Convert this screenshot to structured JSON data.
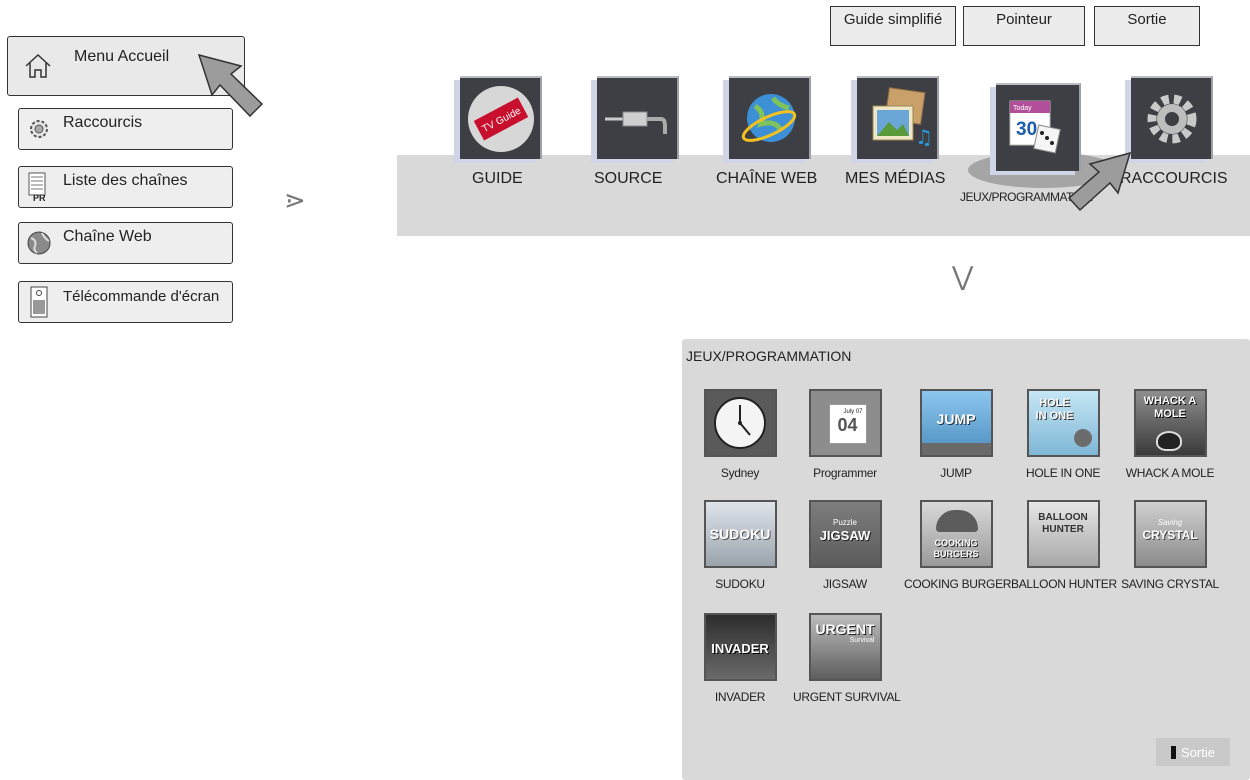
{
  "left_menu": {
    "home": "Menu Accueil",
    "items": [
      "Raccourcis",
      "Liste des chaînes",
      "Chaîne Web",
      "Télécommande d'écran"
    ],
    "channel_list_badge": "PR"
  },
  "arrows": {
    "right": "⋗",
    "down": "⋁"
  },
  "top_buttons": {
    "simple_guide": "Guide simplifié",
    "pointer": "Pointeur",
    "exit": "Sortie"
  },
  "home_bar": {
    "items": [
      "GUIDE",
      "SOURCE",
      "CHAÎNE WEB",
      "MES MÉDIAS",
      "JEUX/PROGRAMMATION",
      "RACCOURCIS"
    ],
    "selected": "JEUX/PROGRAMMATION",
    "guide_tile_text": "TV Guide",
    "calendar_tile_text": {
      "top": "Today",
      "number": "30"
    }
  },
  "games_panel": {
    "title": "JEUX/PROGRAMMATION",
    "items": [
      {
        "label": "Sydney",
        "thumb": "Sydney"
      },
      {
        "label": "Programmer",
        "thumb": "04",
        "thumb_top": "July 07"
      },
      {
        "label": "JUMP",
        "thumb": "JUMP"
      },
      {
        "label": "HOLE IN ONE",
        "thumb": "HOLE IN ONE"
      },
      {
        "label": "WHACK A MOLE",
        "thumb": "WHACK A MOLE"
      },
      {
        "label": "SUDOKU",
        "thumb": "SUDOKU"
      },
      {
        "label": "JIGSAW",
        "thumb": "JIGSAW",
        "thumb_top": "Puzzle"
      },
      {
        "label": "COOKING BURGER",
        "thumb": "COOKING BURGERS"
      },
      {
        "label": "BALLOON HUNTER",
        "thumb": "BALLOON HUNTER"
      },
      {
        "label": "SAVING CRYSTAL",
        "thumb": "CRYSTAL",
        "thumb_top": "Saving"
      },
      {
        "label": "INVADER",
        "thumb": "INVADER"
      },
      {
        "label": "URGENT SURVIVAL",
        "thumb": "URGENT",
        "thumb_top": "Survival"
      }
    ],
    "exit": "Sortie"
  },
  "colors": {
    "panel": "#d9d9d9",
    "tile": "#3d3f44",
    "bar": "#d9d9d9"
  }
}
